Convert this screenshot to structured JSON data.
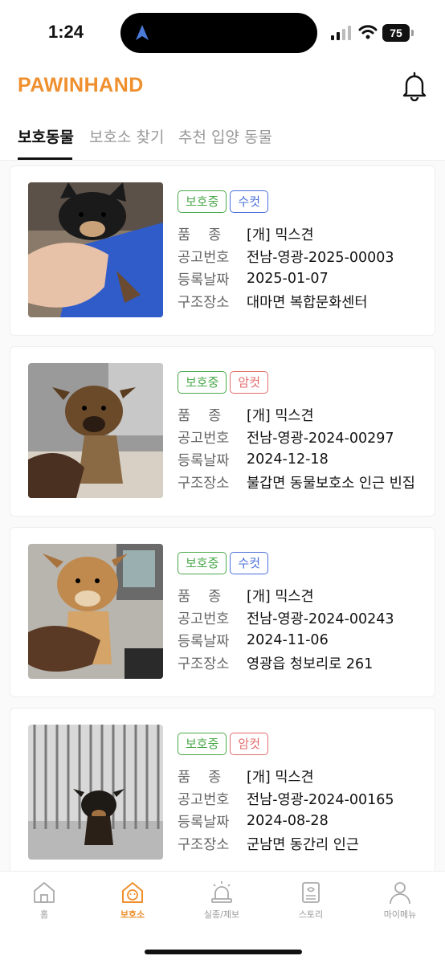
{
  "status_bar": {
    "time": "1:24",
    "battery": "75"
  },
  "brand": "PAWINHAND",
  "tabs": [
    {
      "label": "보호동물"
    },
    {
      "label": "보호소 찾기"
    },
    {
      "label": "추천 입양 동물"
    }
  ],
  "field_labels": {
    "breed": "품종",
    "notice": "공고번호",
    "date": "등록날짜",
    "place": "구조장소"
  },
  "animals": [
    {
      "status": "보호중",
      "sex": "수컷",
      "breed": "[개] 믹스견",
      "notice": "전남-영광-2025-00003",
      "date": "2025-01-07",
      "place": "대마면 복합문화센터"
    },
    {
      "status": "보호중",
      "sex": "암컷",
      "breed": "[개] 믹스견",
      "notice": "전남-영광-2024-00297",
      "date": "2024-12-18",
      "place": "불갑면 동물보호소 인근 빈집"
    },
    {
      "status": "보호중",
      "sex": "수컷",
      "breed": "[개] 믹스견",
      "notice": "전남-영광-2024-00243",
      "date": "2024-11-06",
      "place": "영광읍 청보리로 261"
    },
    {
      "status": "보호중",
      "sex": "암컷",
      "breed": "[개] 믹스견",
      "notice": "전남-영광-2024-00165",
      "date": "2024-08-28",
      "place": "군남면 동간리 인근"
    }
  ],
  "bottom_nav": [
    {
      "label": "홈",
      "icon": "home-icon"
    },
    {
      "label": "보호소",
      "icon": "shelter-icon"
    },
    {
      "label": "실종/제보",
      "icon": "siren-icon"
    },
    {
      "label": "스토리",
      "icon": "story-icon"
    },
    {
      "label": "마이메뉴",
      "icon": "person-icon"
    }
  ],
  "colors": {
    "brand": "#ef8f2e",
    "protected": "#4aa84a",
    "male": "#4a6fd9",
    "female": "#e36b6b"
  }
}
